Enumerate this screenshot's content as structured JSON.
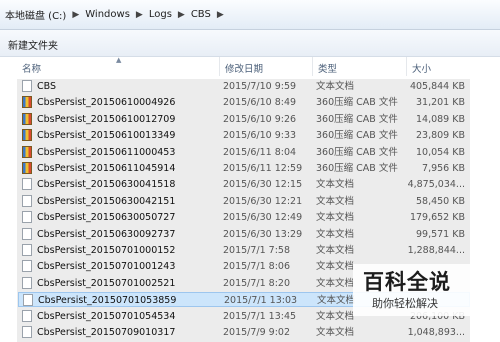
{
  "breadcrumb": [
    "本地磁盘 (C:)",
    "Windows",
    "Logs",
    "CBS"
  ],
  "toolbar": {
    "new_folder": "新建文件夹"
  },
  "columns": {
    "name": "名称",
    "date": "修改日期",
    "type": "类型",
    "size": "大小"
  },
  "files": [
    {
      "name": "CBS",
      "date": "2015/7/10 9:59",
      "type": "文本文档",
      "size": "405,844 KB",
      "icon": "text-file-icon"
    },
    {
      "name": "CbsPersist_20150610004926",
      "date": "2015/6/10 8:49",
      "type": "360压缩 CAB 文件",
      "size": "31,201 KB",
      "icon": "cab-archive-icon"
    },
    {
      "name": "CbsPersist_20150610012709",
      "date": "2015/6/10 9:26",
      "type": "360压缩 CAB 文件",
      "size": "14,089 KB",
      "icon": "cab-archive-icon"
    },
    {
      "name": "CbsPersist_20150610013349",
      "date": "2015/6/10 9:33",
      "type": "360压缩 CAB 文件",
      "size": "23,809 KB",
      "icon": "cab-archive-icon"
    },
    {
      "name": "CbsPersist_20150611000453",
      "date": "2015/6/11 8:04",
      "type": "360压缩 CAB 文件",
      "size": "10,054 KB",
      "icon": "cab-archive-icon"
    },
    {
      "name": "CbsPersist_20150611045914",
      "date": "2015/6/11 12:59",
      "type": "360压缩 CAB 文件",
      "size": "7,956 KB",
      "icon": "cab-archive-icon"
    },
    {
      "name": "CbsPersist_20150630041518",
      "date": "2015/6/30 12:15",
      "type": "文本文档",
      "size": "4,875,034...",
      "icon": "text-file-icon"
    },
    {
      "name": "CbsPersist_20150630042151",
      "date": "2015/6/30 12:21",
      "type": "文本文档",
      "size": "58,450 KB",
      "icon": "text-file-icon"
    },
    {
      "name": "CbsPersist_20150630050727",
      "date": "2015/6/30 12:49",
      "type": "文本文档",
      "size": "179,652 KB",
      "icon": "text-file-icon"
    },
    {
      "name": "CbsPersist_20150630092737",
      "date": "2015/6/30 13:29",
      "type": "文本文档",
      "size": "99,571 KB",
      "icon": "text-file-icon"
    },
    {
      "name": "CbsPersist_20150701000152",
      "date": "2015/7/1 7:58",
      "type": "文本文档",
      "size": "1,288,844...",
      "icon": "text-file-icon"
    },
    {
      "name": "CbsPersist_20150701001243",
      "date": "2015/7/1 8:06",
      "type": "文本文档",
      "size": "",
      "icon": "text-file-icon"
    },
    {
      "name": "CbsPersist_20150701002521",
      "date": "2015/7/1 8:20",
      "type": "文本文档",
      "size": "",
      "icon": "text-file-icon"
    },
    {
      "name": "CbsPersist_20150701053859",
      "date": "2015/7/1 13:03",
      "type": "文本文档",
      "size": "",
      "icon": "text-file-icon",
      "selected": true
    },
    {
      "name": "CbsPersist_20150701054534",
      "date": "2015/7/1 13:45",
      "type": "文本文档",
      "size": "206,100 KB",
      "icon": "text-file-icon"
    },
    {
      "name": "CbsPersist_20150709010317",
      "date": "2015/7/9 9:02",
      "type": "文本文档",
      "size": "1,048,893...",
      "icon": "text-file-icon"
    }
  ],
  "watermark": {
    "title": "百科全说",
    "subtitle": "助你轻松解决"
  }
}
